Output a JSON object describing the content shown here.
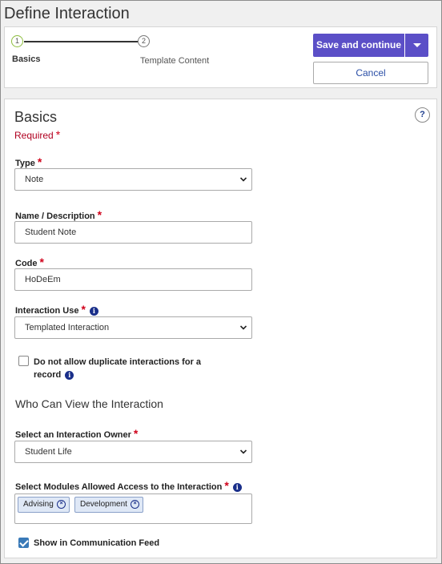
{
  "page": {
    "title": "Define Interaction"
  },
  "steps": [
    {
      "number": "1",
      "label": "Basics"
    },
    {
      "number": "2",
      "label": "Template Content"
    }
  ],
  "actions": {
    "save_label": "Save and continue",
    "cancel_label": "Cancel"
  },
  "section": {
    "title": "Basics",
    "required_note": "Required",
    "help": "?"
  },
  "form": {
    "required_marker": "*",
    "info_marker": "i",
    "type": {
      "label": "Type",
      "value": "Note"
    },
    "name": {
      "label": "Name / Description",
      "value": "Student Note"
    },
    "code": {
      "label": "Code",
      "value": "HoDeEm"
    },
    "use": {
      "label": "Interaction Use",
      "value": "Templated Interaction"
    },
    "no_duplicates": {
      "label_line1": "Do not allow duplicate interactions for a",
      "label_line2": "record",
      "checked": false
    },
    "who_can_view_title": "Who Can View the Interaction",
    "owner": {
      "label": "Select an Interaction Owner",
      "value": "Student Life"
    },
    "modules": {
      "label": "Select Modules Allowed Access to the Interaction",
      "tags": [
        "Advising",
        "Development"
      ],
      "remove_glyph": "×"
    },
    "show_feed": {
      "label": "Show in Communication Feed",
      "checked": true
    }
  },
  "colors": {
    "primary": "#5b4fc7",
    "required": "#d0021b",
    "info": "#1a2f8a",
    "step_active": "#8dbd3e"
  }
}
